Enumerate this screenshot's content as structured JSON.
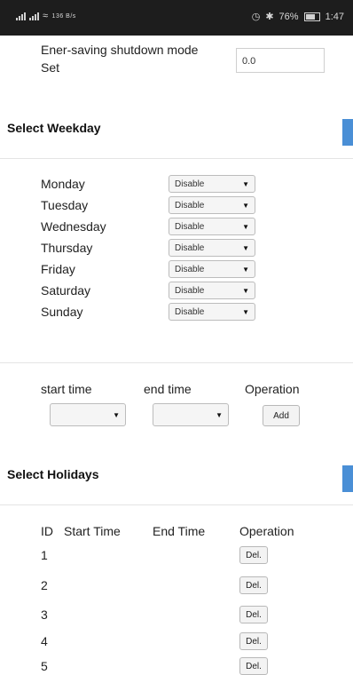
{
  "status_bar": {
    "left_text": "4G 4G",
    "speed": "136 B/s",
    "battery": "76%",
    "time": "1:47"
  },
  "energy": {
    "label_line1": "Ener-saving shutdown mode",
    "label_line2": "Set",
    "value": "0.0"
  },
  "weekday": {
    "title": "Select Weekday",
    "days": [
      {
        "label": "Monday",
        "value": "Disable"
      },
      {
        "label": "Tuesday",
        "value": "Disable"
      },
      {
        "label": "Wednesday",
        "value": "Disable"
      },
      {
        "label": "Thursday",
        "value": "Disable"
      },
      {
        "label": "Friday",
        "value": "Disable"
      },
      {
        "label": "Saturday",
        "value": "Disable"
      },
      {
        "label": "Sunday",
        "value": "Disable"
      }
    ],
    "col_start": "start time",
    "col_end": "end time",
    "col_op": "Operation",
    "add_label": "Add"
  },
  "holidays": {
    "title": "Select Holidays",
    "headers": [
      "ID",
      "Start Time",
      "End Time",
      "Operation"
    ],
    "rows": [
      {
        "id": "1",
        "action": "Del."
      },
      {
        "id": "2",
        "action": "Del."
      },
      {
        "id": "3",
        "action": "Del."
      },
      {
        "id": "4",
        "action": "Del."
      },
      {
        "id": "5",
        "action": "Del."
      }
    ]
  }
}
